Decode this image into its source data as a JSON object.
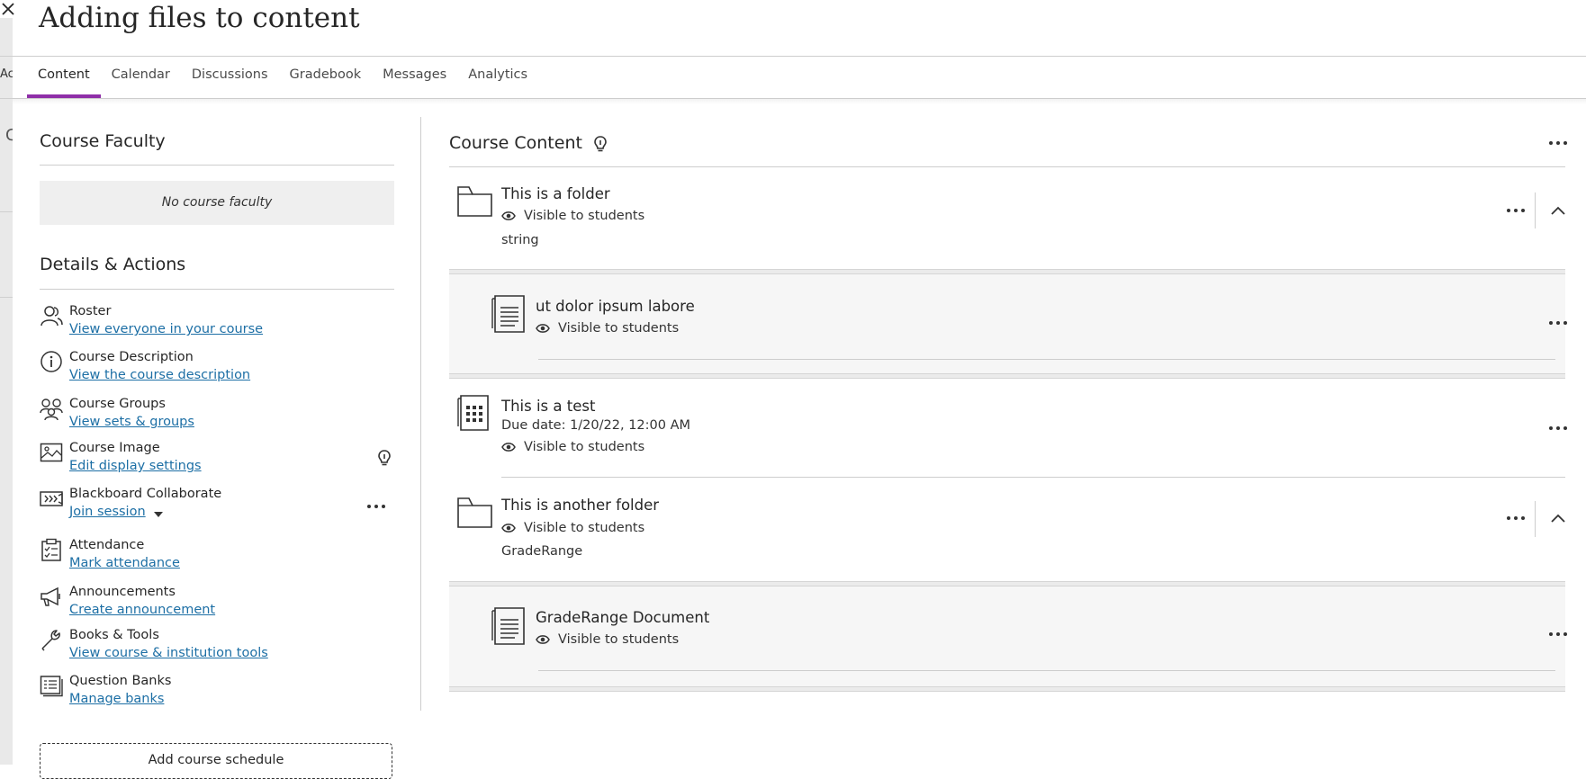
{
  "page_title": "Adding files to content",
  "background_peek": {
    "text1": "Ac",
    "text2": "C"
  },
  "tabs": [
    {
      "label": "Content",
      "active": true
    },
    {
      "label": "Calendar",
      "active": false
    },
    {
      "label": "Discussions",
      "active": false
    },
    {
      "label": "Gradebook",
      "active": false
    },
    {
      "label": "Messages",
      "active": false
    },
    {
      "label": "Analytics",
      "active": false
    }
  ],
  "left": {
    "faculty_heading": "Course Faculty",
    "no_faculty_text": "No course faculty",
    "details_heading": "Details & Actions",
    "items": [
      {
        "icon": "roster-icon",
        "title": "Roster",
        "link": "View everyone in your course"
      },
      {
        "icon": "info-icon",
        "title": "Course Description",
        "link": "View the course description"
      },
      {
        "icon": "groups-icon",
        "title": "Course Groups",
        "link": "View sets & groups"
      },
      {
        "icon": "image-icon",
        "title": "Course Image",
        "link": "Edit display settings"
      },
      {
        "icon": "collaborate-icon",
        "title": "Blackboard Collaborate",
        "link": "Join session"
      },
      {
        "icon": "attendance-icon",
        "title": "Attendance",
        "link": "Mark attendance"
      },
      {
        "icon": "megaphone-icon",
        "title": "Announcements",
        "link": "Create announcement"
      },
      {
        "icon": "wrench-icon",
        "title": "Books & Tools",
        "link": "View course & institution tools"
      },
      {
        "icon": "question-bank-icon",
        "title": "Question Banks",
        "link": "Manage banks"
      }
    ],
    "schedule_button": "Add course schedule"
  },
  "content": {
    "heading": "Course Content",
    "items": [
      {
        "type": "folder",
        "title": "This is a folder",
        "visibility": "Visible to students",
        "description": "string"
      },
      {
        "type": "document",
        "title": "ut dolor ipsum labore",
        "visibility": "Visible to students",
        "nested": true
      },
      {
        "type": "test",
        "title": "This is a test",
        "due": "Due date: 1/20/22, 12:00 AM",
        "visibility": "Visible to students"
      },
      {
        "type": "folder",
        "title": "This is another folder",
        "visibility": "Visible to students",
        "description": "GradeRange"
      },
      {
        "type": "document",
        "title": "GradeRange Document",
        "visibility": "Visible to students",
        "nested": true
      }
    ]
  },
  "colors": {
    "accent": "#8f2fa8",
    "link": "#1d6fa5",
    "text": "#262626"
  }
}
